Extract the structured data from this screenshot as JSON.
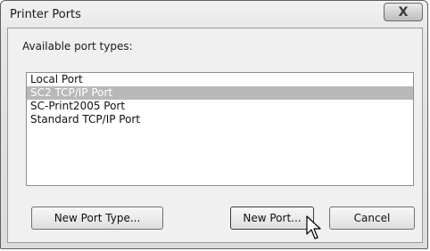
{
  "window": {
    "title": "Printer Ports",
    "close_glyph": "X"
  },
  "ports": {
    "label": "Available port types:",
    "items": [
      {
        "label": "Local Port",
        "selected": false
      },
      {
        "label": "SC2 TCP/IP Port",
        "selected": true
      },
      {
        "label": "SC-Print2005 Port",
        "selected": false
      },
      {
        "label": "Standard TCP/IP Port",
        "selected": false
      }
    ]
  },
  "buttons": {
    "new_port_type": "New Port Type...",
    "new_port": "New Port...",
    "cancel": "Cancel"
  },
  "icons": {
    "close": "close-icon",
    "cursor": "mouse-pointer-icon"
  }
}
